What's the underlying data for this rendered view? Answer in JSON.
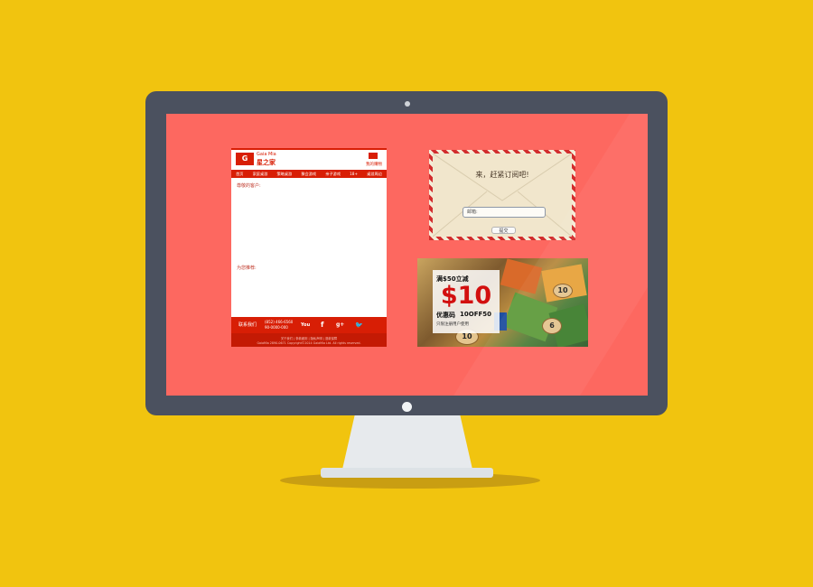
{
  "colors": {
    "background": "#f1c40f",
    "screen": "#fd6860",
    "bezel": "#4b515f",
    "brand_red": "#d81e05"
  },
  "email": {
    "brand_en": "Gaia Mia",
    "brand_cn": "星之家",
    "logo_icon": "brand-logo-icon",
    "cart_label": "我的購物",
    "nav": [
      "首页",
      "家庭桌游",
      "策略桌游",
      "聚会游戏",
      "亲子游戏",
      "18+",
      "桌游周边"
    ],
    "greeting": "尊敬的客户:",
    "recommend_label": "为您推荐:",
    "contact_label": "联系我们",
    "phone": "(852) 466-6560",
    "phone2": "90-0000-000",
    "social_icons": [
      "youtube-icon",
      "facebook-icon",
      "google-plus-icon",
      "twitter-icon"
    ],
    "social": {
      "youtube": "You",
      "facebook": "f",
      "gplus": "g+",
      "twitter": "🐦"
    },
    "legal1": "关于我们 | 条款细则 | 隐私声明 | 退款保障",
    "legal2": "GaiaMia 2890-0671 Copyright©2014 GaiaMia Ltd. All rights reserved."
  },
  "subscribe": {
    "title": "来，赶紧订阅吧!",
    "email_label": "邮箱:",
    "email_value": "",
    "button": "提交"
  },
  "promo": {
    "condition": "满$50立减",
    "amount": "$10",
    "code_label": "优惠码",
    "code": "10OFF50",
    "note": "只限注册用户使用"
  }
}
